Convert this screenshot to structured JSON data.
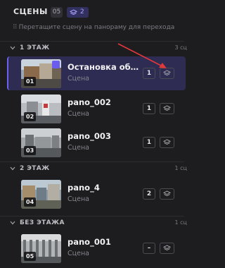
{
  "header": {
    "title": "СЦЕНЫ",
    "scene_count": "05",
    "floor_count": "2",
    "hint": "Перетащите сцену на панораму для перехода"
  },
  "groups": [
    {
      "name": "1 ЭТАЖ",
      "count": "3 сц",
      "scenes": [
        {
          "num": "01",
          "name": "Остановка об…",
          "subtitle": "Сцена",
          "badge": "1",
          "selected": true
        },
        {
          "num": "02",
          "name": "pano_002",
          "subtitle": "Сцена",
          "badge": "1"
        },
        {
          "num": "03",
          "name": "pano_003",
          "subtitle": "Сцена",
          "badge": "1"
        }
      ]
    },
    {
      "name": "2 ЭТАЖ",
      "count": "1 сц",
      "scenes": [
        {
          "num": "04",
          "name": "pano_4",
          "subtitle": "Сцена",
          "badge": "2"
        }
      ]
    },
    {
      "name": "БЕЗ ЭТАЖА",
      "count": "1 сц",
      "scenes": [
        {
          "num": "05",
          "name": "pano_001",
          "subtitle": "Сцена",
          "badge": "–"
        }
      ]
    }
  ],
  "colors": {
    "background": "#1d1d20",
    "selected_row": "#2e2c52",
    "accent": "#6b62f0",
    "annotation_arrow": "#e0383b"
  },
  "icons": {
    "collapse": "chevron-down-icon",
    "floors": "layers-icon",
    "drag": "drag-grip-icon",
    "panorama": "panorama-icon"
  }
}
